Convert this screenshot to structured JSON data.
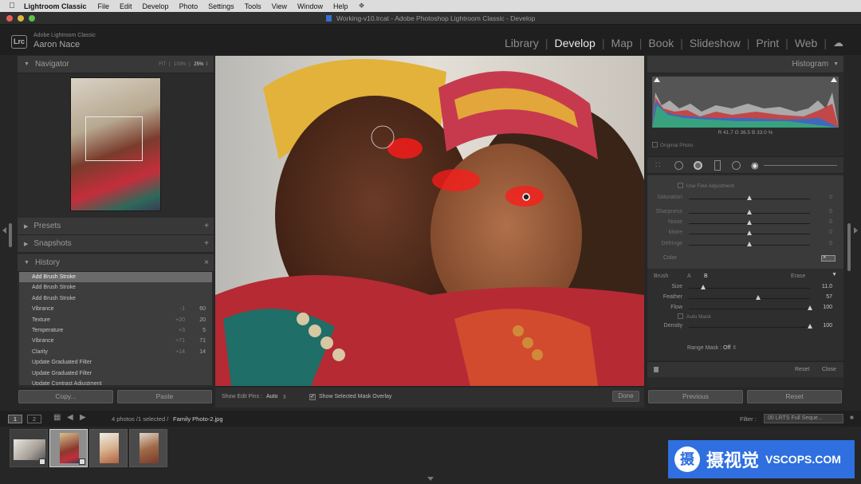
{
  "menubar": {
    "app": "Lightroom Classic",
    "items": [
      "File",
      "Edit",
      "Develop",
      "Photo",
      "Settings",
      "Tools",
      "View",
      "Window",
      "Help"
    ]
  },
  "window": {
    "title": "Working-v10.lrcat - Adobe Photoshop Lightroom Classic - Develop"
  },
  "identity": {
    "product": "Adobe Lightroom Classic",
    "user": "Aaron Nace",
    "badge": "Lrc"
  },
  "modules": [
    "Library",
    "Develop",
    "Map",
    "Book",
    "Slideshow",
    "Print",
    "Web"
  ],
  "active_module": "Develop",
  "navigator": {
    "title": "Navigator",
    "zoom_options": [
      "FIT",
      "100%",
      "25%"
    ]
  },
  "panels": {
    "presets": "Presets",
    "snapshots": "Snapshots",
    "history": "History"
  },
  "history": [
    {
      "label": "Add Brush Stroke",
      "a": "",
      "b": "",
      "selected": true
    },
    {
      "label": "Add Brush Stroke",
      "a": "",
      "b": ""
    },
    {
      "label": "Add Brush Stroke",
      "a": "",
      "b": ""
    },
    {
      "label": "Vibrance",
      "a": "-1",
      "b": "60"
    },
    {
      "label": "Texture",
      "a": "+20",
      "b": "20"
    },
    {
      "label": "Temperature",
      "a": "+3",
      "b": "5"
    },
    {
      "label": "Vibrance",
      "a": "+71",
      "b": "71"
    },
    {
      "label": "Clarity",
      "a": "+14",
      "b": "14"
    },
    {
      "label": "Update Graduated Filter",
      "a": "",
      "b": ""
    },
    {
      "label": "Update Graduated Filter",
      "a": "",
      "b": ""
    },
    {
      "label": "Update Contrast Adjustment",
      "a": "",
      "b": ""
    }
  ],
  "left_buttons": {
    "copy": "Copy...",
    "paste": "Paste"
  },
  "toolbar": {
    "pins_label": "Show Edit Pins :",
    "pins_value": "Auto",
    "overlay_label": "Show Selected Mask Overlay",
    "overlay_checked": true,
    "done": "Done"
  },
  "histogram": {
    "title": "Histogram",
    "readout": "R  41.7  G  36.5  B  33.0 %",
    "original_photo": "Original Photo"
  },
  "fine_adjust": "Use Fine Adjustment",
  "sliders_top": [
    {
      "label": "Saturation",
      "value": "0",
      "pos": 0.5
    },
    {
      "label": "Sharpness",
      "value": "0",
      "pos": 0.5
    },
    {
      "label": "Noise",
      "value": "0",
      "pos": 0.5
    },
    {
      "label": "Moire",
      "value": "0",
      "pos": 0.5
    },
    {
      "label": "Defringe",
      "value": "0",
      "pos": 0.5
    }
  ],
  "color_label": "Color",
  "brush": {
    "label": "Brush",
    "a": "A",
    "b": "B",
    "erase": "Erase",
    "auto_mask": "Auto Mask",
    "range_mask_label": "Range Mask :",
    "range_mask_value": "Off",
    "reset": "Reset",
    "close": "Close"
  },
  "sliders_brush": [
    {
      "label": "Size",
      "value": "11.0",
      "pos": 0.12
    },
    {
      "label": "Feather",
      "value": "57",
      "pos": 0.57
    },
    {
      "label": "Flow",
      "value": "100",
      "pos": 1.0
    },
    {
      "label": "Density",
      "value": "100",
      "pos": 1.0
    }
  ],
  "right_buttons": {
    "previous": "Previous",
    "reset": "Reset"
  },
  "filmstrip": {
    "views": [
      "1",
      "2"
    ],
    "info_prefix": "4 photos /1 selected /",
    "filename": "Family Photo-2.jpg",
    "filter_label": "Filter :",
    "filter_value": "00 LRTS Full Seque..."
  },
  "watermark": {
    "cn": "摄视觉",
    "en": "VSCOPS.COM",
    "glyph": "摄"
  },
  "colors": {
    "accent": "#2f6fe0",
    "mask": "#ff1a1a"
  }
}
